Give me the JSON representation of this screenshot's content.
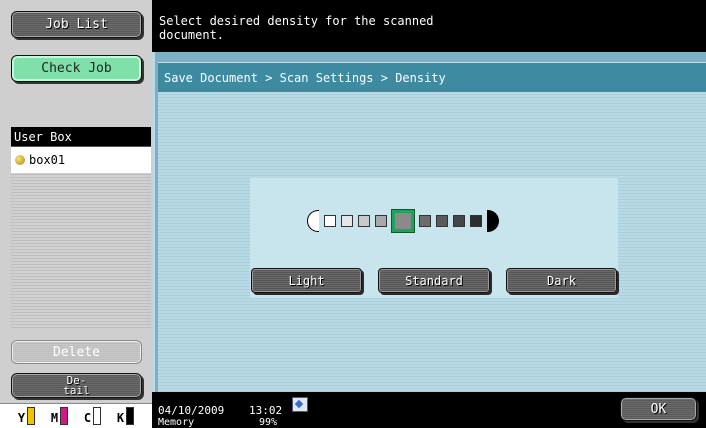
{
  "left_panel": {
    "job_list_label": "Job List",
    "check_job_label": "Check Job",
    "user_box_header": "User Box",
    "user_box_items": [
      "box01"
    ],
    "delete_label": "Delete",
    "detail_label_line1": "De-",
    "detail_label_line2": "tail",
    "toner": [
      {
        "label": "Y",
        "color": "#f2c200"
      },
      {
        "label": "M",
        "color": "#d0198a"
      },
      {
        "label": "C",
        "color": "#18a6d8"
      },
      {
        "label": "K",
        "color": "#000000"
      }
    ]
  },
  "message": {
    "line1": "Select desired density for the scanned",
    "line2": "document."
  },
  "breadcrumb": "Save Document > Scan Settings > Density",
  "density": {
    "levels": 9,
    "selected_index": 4,
    "colors": [
      "#ffffff",
      "#e6e6e6",
      "#c9c9c9",
      "#a8a8a8",
      "#8a8a8a",
      "#6c6c6c",
      "#5a5a5a",
      "#454545",
      "#2e2e2e"
    ],
    "light_label": "Light",
    "standard_label": "Standard",
    "dark_label": "Dark"
  },
  "status": {
    "date": "04/10/2009",
    "time": "13:02",
    "memory_label": "Memory",
    "memory_value": "99%",
    "icon": "scan-status-icon"
  },
  "ok_label": "OK"
}
